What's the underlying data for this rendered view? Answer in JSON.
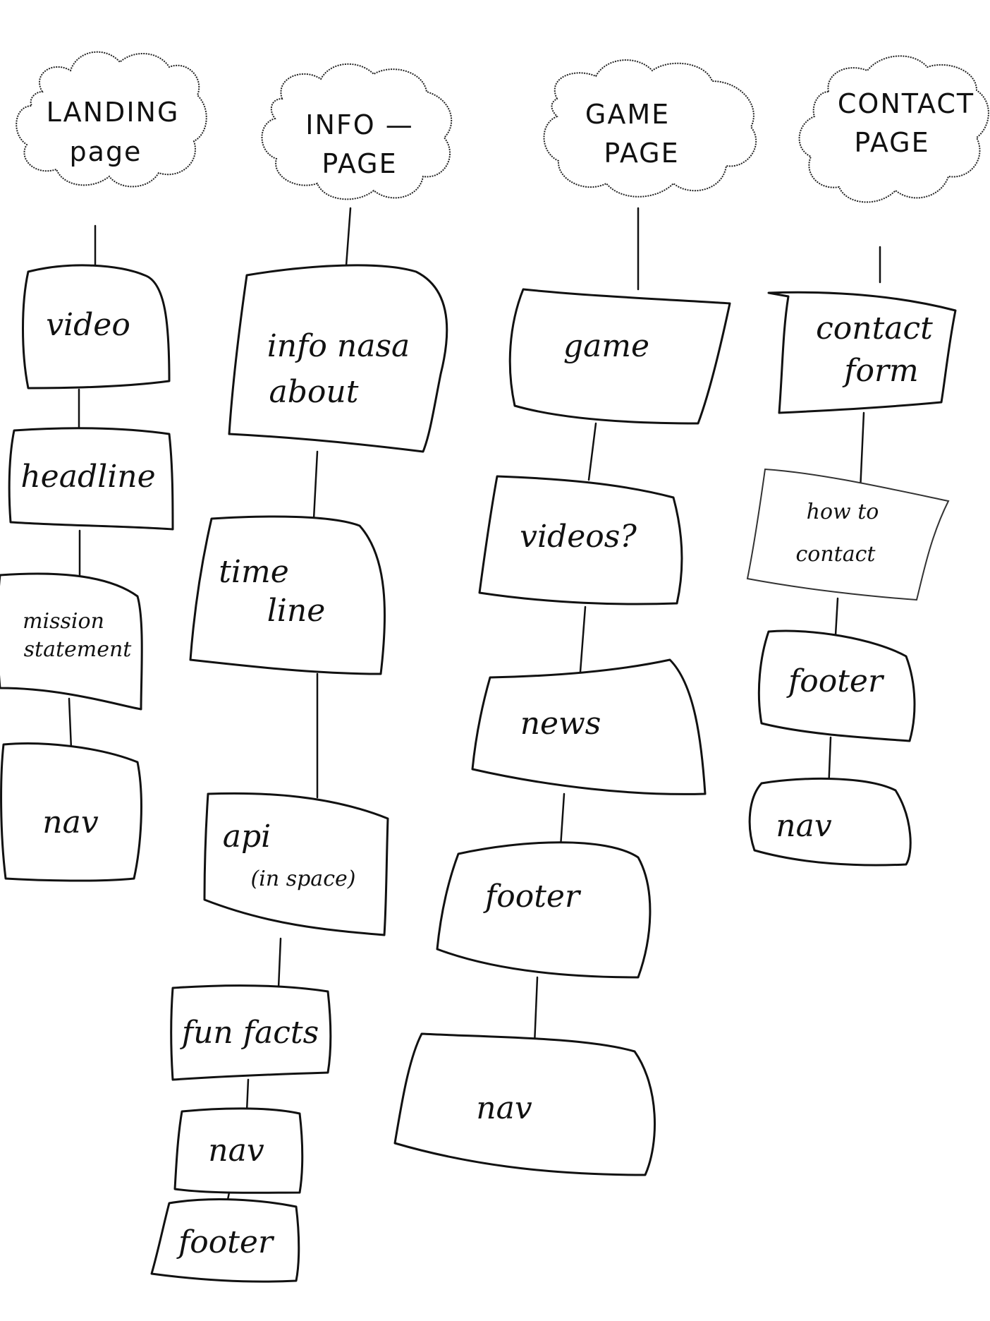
{
  "columns": [
    {
      "title_lines": [
        "LANDING",
        "page"
      ],
      "boxes": [
        {
          "lines": [
            "video"
          ]
        },
        {
          "lines": [
            "headline"
          ]
        },
        {
          "lines": [
            "mission",
            "statement"
          ]
        },
        {
          "lines": [
            "nav"
          ]
        }
      ]
    },
    {
      "title_lines": [
        "INFO —",
        "PAGE"
      ],
      "boxes": [
        {
          "lines": [
            "info nasa",
            "about"
          ]
        },
        {
          "lines": [
            "time",
            "line"
          ]
        },
        {
          "lines": [
            "api",
            "(in space)"
          ]
        },
        {
          "lines": [
            "fun facts"
          ]
        },
        {
          "lines": [
            "nav"
          ]
        },
        {
          "lines": [
            "footer"
          ]
        }
      ]
    },
    {
      "title_lines": [
        "GAME",
        "PAGE"
      ],
      "boxes": [
        {
          "lines": [
            "game"
          ]
        },
        {
          "lines": [
            "videos?"
          ]
        },
        {
          "lines": [
            "news"
          ]
        },
        {
          "lines": [
            "footer"
          ]
        },
        {
          "lines": [
            "nav"
          ]
        }
      ]
    },
    {
      "title_lines": [
        "CONTACT",
        "PAGE"
      ],
      "boxes": [
        {
          "lines": [
            "contact",
            "form"
          ]
        },
        {
          "lines": [
            "how to",
            "contact"
          ]
        },
        {
          "lines": [
            "footer"
          ]
        },
        {
          "lines": [
            "nav"
          ]
        }
      ]
    }
  ]
}
